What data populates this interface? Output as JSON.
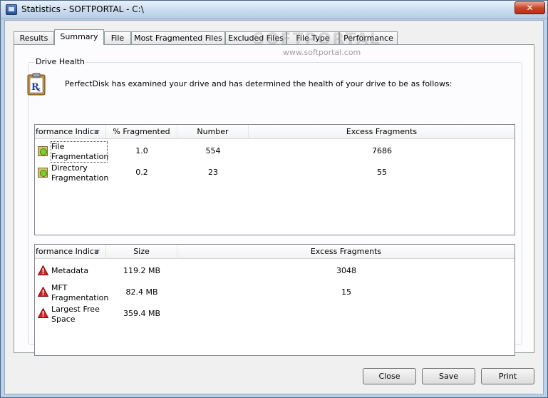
{
  "window": {
    "title": "Statistics - SOFTPORTAL - C:\\",
    "close_glyph": "✕"
  },
  "tabs": [
    {
      "label": "Results"
    },
    {
      "label": "Summary"
    },
    {
      "label": "File"
    },
    {
      "label": "Most Fragmented Files"
    },
    {
      "label": "Excluded Files"
    },
    {
      "label": "File Type"
    },
    {
      "label": "Performance"
    }
  ],
  "group": {
    "title": "Drive Health"
  },
  "intro": "PerfectDisk has examined your drive and has determined the health of your drive to be as follows:",
  "table1": {
    "headers": [
      "formance Indica",
      "% Fragmented",
      "Number",
      "Excess Fragments"
    ],
    "rows": [
      {
        "name": "File Fragmentation",
        "pct": "1.0",
        "number": "554",
        "excess": "7686",
        "icon": "ok-status-icon"
      },
      {
        "name": "Directory Fragmentation",
        "pct": "0.2",
        "number": "23",
        "excess": "55",
        "icon": "ok-status-icon"
      }
    ]
  },
  "table2": {
    "headers": [
      "formance Indica",
      "Size",
      "Excess Fragments"
    ],
    "rows": [
      {
        "name": "Metadata",
        "size": "119.2 MB",
        "excess": "3048",
        "icon": "warning-icon"
      },
      {
        "name": "MFT Fragmentation",
        "size": "82.4 MB",
        "excess": "15",
        "icon": "warning-icon"
      },
      {
        "name": "Largest Free Space",
        "size": "359.4 MB",
        "excess": "",
        "icon": "warning-icon"
      }
    ]
  },
  "buttons": {
    "close": "Close",
    "save": "Save",
    "print": "Print"
  },
  "watermark": {
    "big": "SOFTPORTAL",
    "small": "www.softportal.com"
  },
  "colors": {
    "ok": "#7fcf2a",
    "warning": "#d42020",
    "accent": "#4a6484"
  }
}
